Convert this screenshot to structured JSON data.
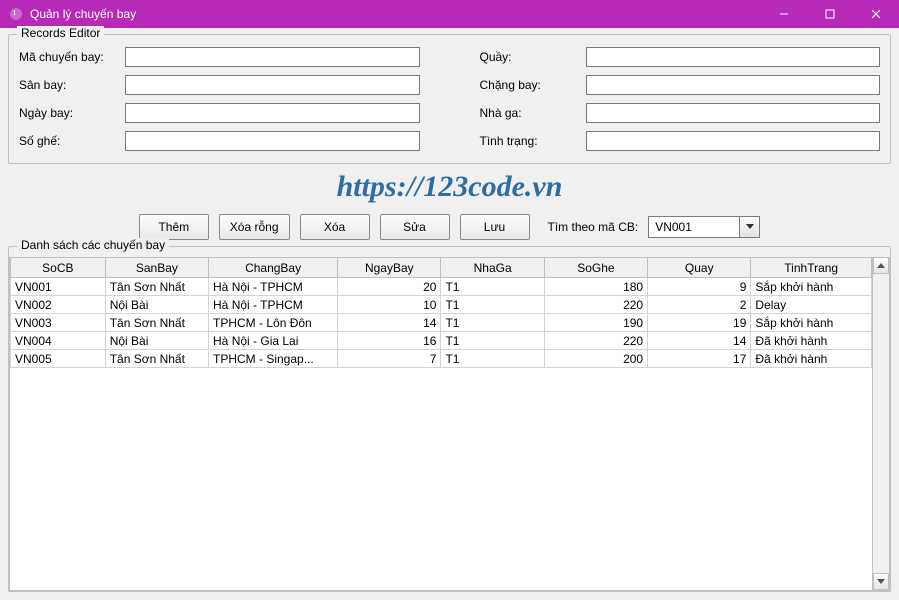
{
  "window": {
    "title": "Quản lý chuyến bay"
  },
  "editor": {
    "legend": "Records Editor",
    "labels": {
      "ma_cb": "Mã chuyến bay:",
      "san_bay": "Sân bay:",
      "ngay_bay": "Ngày bay:",
      "so_ghe": "Số ghế:",
      "quay": "Quầy:",
      "chang_bay": "Chặng bay:",
      "nha_ga": "Nhà ga:",
      "tinh_trang": "Tình trạng:"
    },
    "values": {
      "ma_cb": "",
      "san_bay": "",
      "ngay_bay": "",
      "so_ghe": "",
      "quay": "",
      "chang_bay": "",
      "nha_ga": "",
      "tinh_trang": ""
    }
  },
  "watermark": "https://123code.vn",
  "toolbar": {
    "them": "Thêm",
    "xoa_rong": "Xóa rỗng",
    "xoa": "Xóa",
    "sua": "Sửa",
    "luu": "Lưu",
    "search_label": "Tìm theo mã CB:",
    "search_value": "VN001"
  },
  "list": {
    "legend": "Danh sách các chuyến bay",
    "columns": [
      "SoCB",
      "SanBay",
      "ChangBay",
      "NgayBay",
      "NhaGa",
      "SoGhe",
      "Quay",
      "TinhTrang"
    ],
    "rows": [
      {
        "socb": "VN001",
        "sanbay": "Tân Sơn Nhất",
        "changbay": "Hà Nội - TPHCM",
        "ngaybay": "20",
        "nhaga": "T1",
        "soghe": "180",
        "quay": "9",
        "tinhtrang": "Sắp khởi hành"
      },
      {
        "socb": "VN002",
        "sanbay": "Nội Bài",
        "changbay": "Hà Nội - TPHCM",
        "ngaybay": "10",
        "nhaga": "T1",
        "soghe": "220",
        "quay": "2",
        "tinhtrang": "Delay"
      },
      {
        "socb": "VN003",
        "sanbay": "Tân Sơn Nhất",
        "changbay": "TPHCM - Lôn Đôn",
        "ngaybay": "14",
        "nhaga": "T1",
        "soghe": "190",
        "quay": "19",
        "tinhtrang": "Sắp khởi hành"
      },
      {
        "socb": "VN004",
        "sanbay": "Nội Bài",
        "changbay": "Hà Nội - Gia Lai",
        "ngaybay": "16",
        "nhaga": "T1",
        "soghe": "220",
        "quay": "14",
        "tinhtrang": "Đã khởi hành"
      },
      {
        "socb": "VN005",
        "sanbay": "Tân Sơn Nhất",
        "changbay": "TPHCM - Singap...",
        "ngaybay": "7",
        "nhaga": "T1",
        "soghe": "200",
        "quay": "17",
        "tinhtrang": "Đã khởi hành"
      }
    ]
  }
}
